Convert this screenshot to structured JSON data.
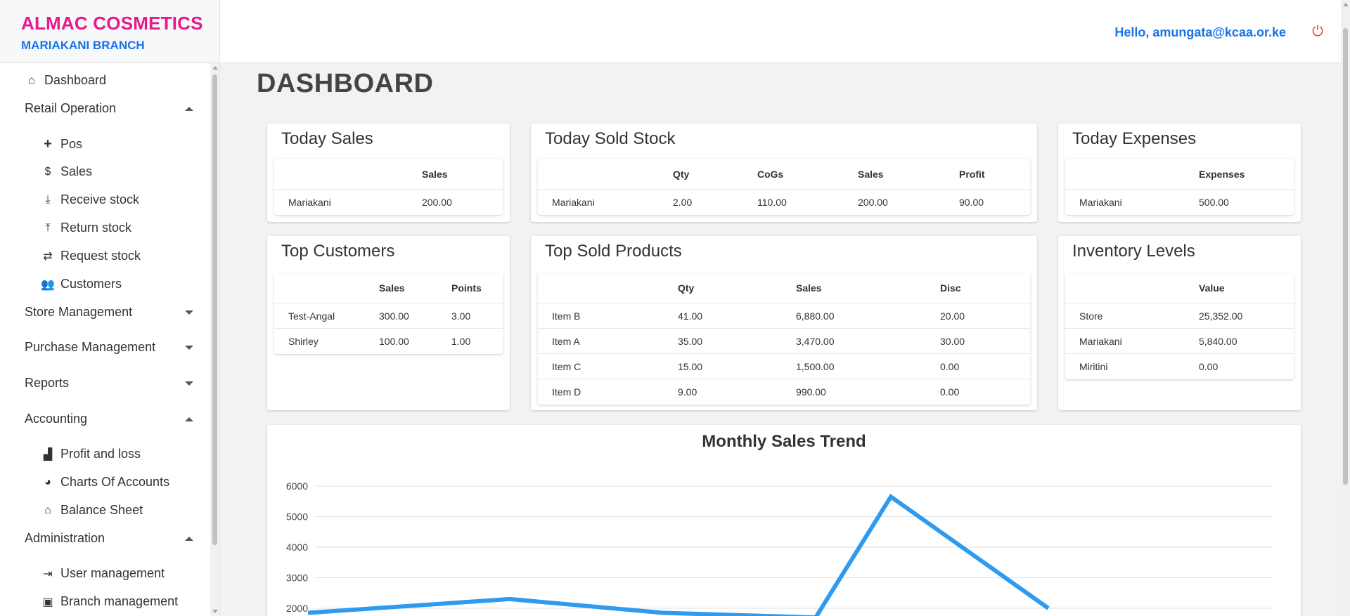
{
  "brand": {
    "name": "ALMAC COSMETICS",
    "branch": "MARIAKANI BRANCH"
  },
  "header": {
    "greeting": "Hello,  amungata@kcaa.or.ke",
    "power_icon": "power-icon"
  },
  "page": {
    "title": "DASHBOARD"
  },
  "sidebar": {
    "dashboard": "Dashboard",
    "retail_operation": {
      "label": "Retail Operation",
      "items": [
        "Pos",
        "Sales",
        "Receive stock",
        "Return stock",
        "Request stock",
        "Customers"
      ]
    },
    "store_management": "Store Management",
    "purchase_management": "Purchase Management",
    "reports": "Reports",
    "accounting": {
      "label": "Accounting",
      "items": [
        "Profit and loss",
        "Charts Of Accounts",
        "Balance Sheet"
      ]
    },
    "administration": {
      "label": "Administration",
      "items": [
        "User management",
        "Branch management"
      ]
    }
  },
  "today_sales": {
    "title": "Today Sales",
    "columns": [
      "",
      "Sales"
    ],
    "rows": [
      [
        "Mariakani",
        "200.00"
      ]
    ]
  },
  "today_sold_stock": {
    "title": "Today Sold Stock",
    "columns": [
      "",
      "Qty",
      "CoGs",
      "Sales",
      "Profit"
    ],
    "rows": [
      [
        "Mariakani",
        "2.00",
        "110.00",
        "200.00",
        "90.00"
      ]
    ]
  },
  "today_expenses": {
    "title": "Today Expenses",
    "columns": [
      "",
      "Expenses"
    ],
    "rows": [
      [
        "Mariakani",
        "500.00"
      ]
    ]
  },
  "top_customers": {
    "title": "Top Customers",
    "columns": [
      "",
      "Sales",
      "Points"
    ],
    "rows": [
      [
        "Test-Angal",
        "300.00",
        "3.00"
      ],
      [
        "Shirley",
        "100.00",
        "1.00"
      ]
    ]
  },
  "top_sold_products": {
    "title": "Top Sold Products",
    "columns": [
      "",
      "Qty",
      "Sales",
      "Disc"
    ],
    "rows": [
      [
        "Item B",
        "41.00",
        "6,880.00",
        "20.00"
      ],
      [
        "Item A",
        "35.00",
        "3,470.00",
        "30.00"
      ],
      [
        "Item C",
        "15.00",
        "1,500.00",
        "0.00"
      ],
      [
        "Item D",
        "9.00",
        "990.00",
        "0.00"
      ]
    ]
  },
  "inventory_levels": {
    "title": "Inventory Levels",
    "columns": [
      "",
      "Value"
    ],
    "rows": [
      [
        "Store",
        "25,352.00"
      ],
      [
        "Mariakani",
        "5,840.00"
      ],
      [
        "Miritini",
        "0.00"
      ]
    ]
  },
  "chart_data": {
    "type": "line",
    "title": "Monthly Sales Trend",
    "y_ticks": [
      2000,
      3000,
      4000,
      5000,
      6000
    ],
    "ylim": [
      2000,
      6000
    ],
    "grid": true,
    "color": "#2e9bf0",
    "series": [
      {
        "values": [
          1850,
          2300,
          1850,
          1700,
          5650,
          2000
        ]
      }
    ]
  }
}
